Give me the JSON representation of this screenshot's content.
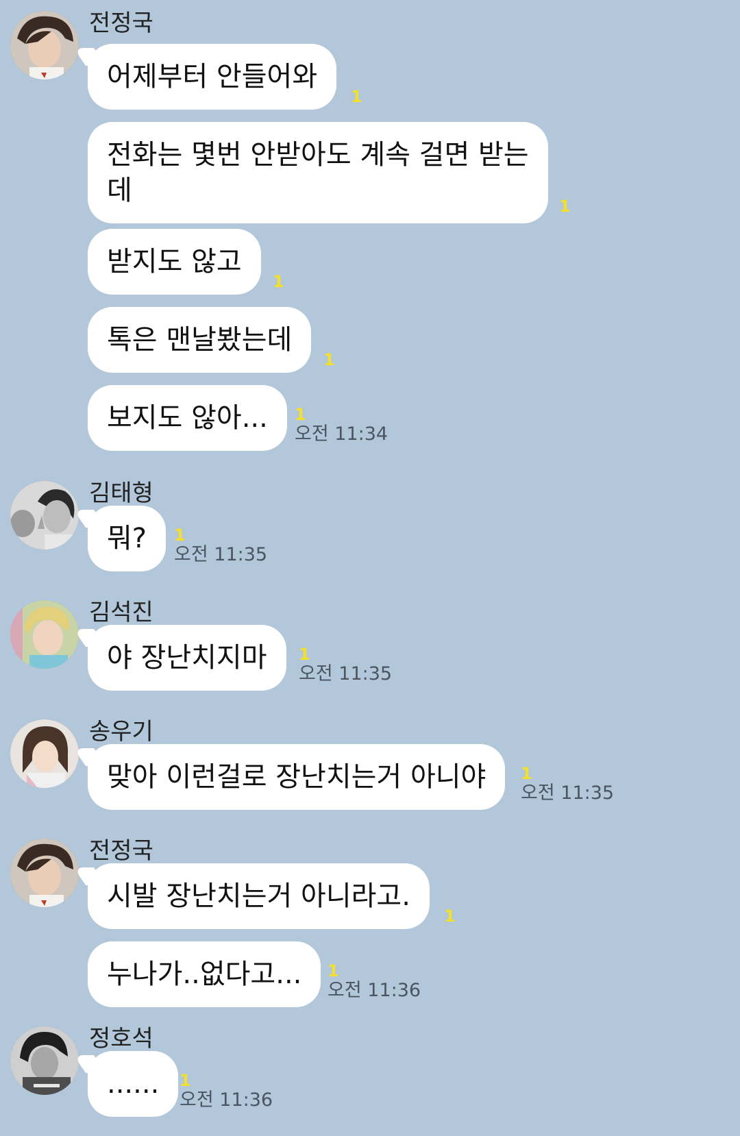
{
  "chat": {
    "messages": [
      {
        "sender": "전정국",
        "avatar_icon": "avatar-jungkook-icon",
        "items": [
          {
            "text": "어제부터 안들어와",
            "unread": "1"
          },
          {
            "text": "전화는 몇번 안받아도 계속 걸면 받는데",
            "unread": "1"
          },
          {
            "text": "받지도 않고",
            "unread": "1"
          },
          {
            "text": "톡은 맨날봤는데",
            "unread": "1"
          },
          {
            "text": "보지도 않아...",
            "unread": "1",
            "time": "오전 11:34"
          }
        ]
      },
      {
        "sender": "김태형",
        "avatar_icon": "avatar-taehyung-icon",
        "items": [
          {
            "text": "뭐?",
            "unread": "1",
            "time": "오전 11:35"
          }
        ]
      },
      {
        "sender": "김석진",
        "avatar_icon": "avatar-seokjin-icon",
        "items": [
          {
            "text": "야 장난치지마",
            "unread": "1",
            "time": "오전 11:35"
          }
        ]
      },
      {
        "sender": "송우기",
        "avatar_icon": "avatar-yuqi-icon",
        "items": [
          {
            "text": "맞아 이런걸로 장난치는거 아니야",
            "unread": "1",
            "time": "오전 11:35"
          }
        ]
      },
      {
        "sender": "전정국",
        "avatar_icon": "avatar-jungkook-icon",
        "items": [
          {
            "text": "시발 장난치는거 아니라고.",
            "unread": "1"
          },
          {
            "text": "누나가..없다고...",
            "unread": "1",
            "time": "오전 11:36"
          }
        ]
      },
      {
        "sender": "정호석",
        "avatar_icon": "avatar-hoseok-icon",
        "items": [
          {
            "text": "......",
            "unread": "1",
            "time": "오전 11:36"
          }
        ]
      }
    ]
  },
  "colors": {
    "background": "#b2c7d9",
    "bubble": "#ffffff",
    "unread": "#f2e02c",
    "time": "#4b5562"
  }
}
